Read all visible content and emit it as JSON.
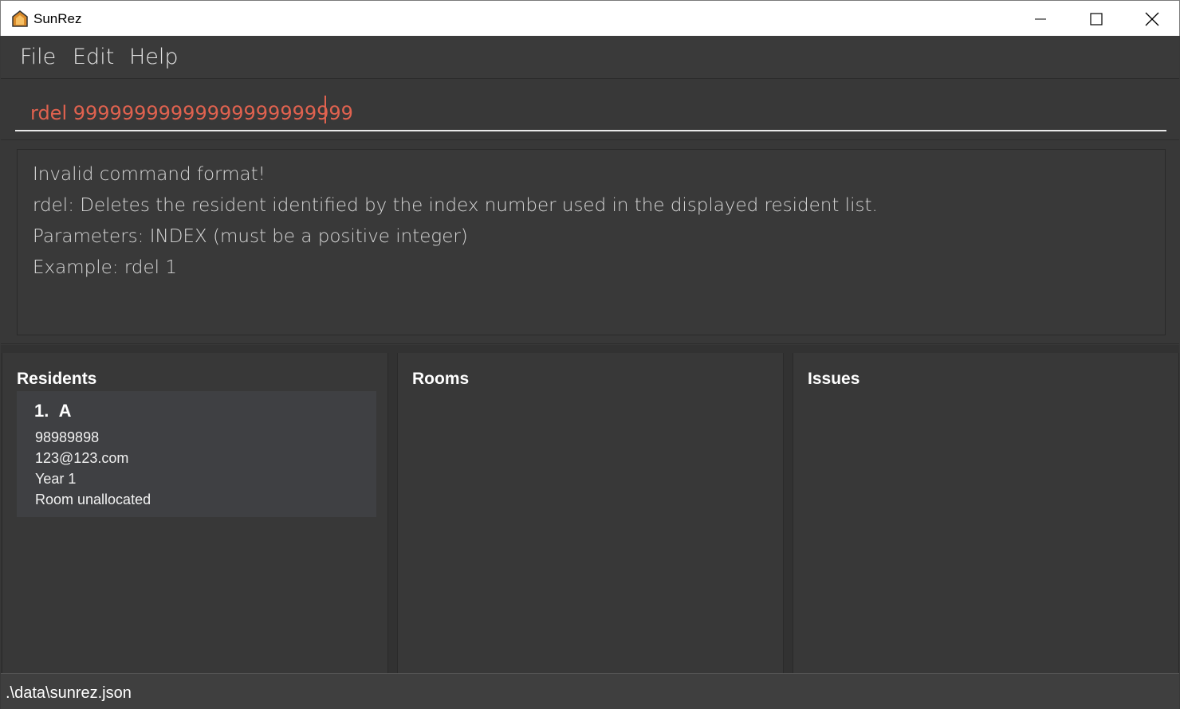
{
  "window": {
    "title": "SunRez",
    "icon": "house-icon",
    "controls": [
      "minimize-icon",
      "maximize-icon",
      "close-icon"
    ]
  },
  "menu": {
    "items": [
      "File",
      "Edit",
      "Help"
    ]
  },
  "command": {
    "value": "rdel 99999999999999999999999"
  },
  "result": {
    "lines": [
      "Invalid command format!",
      "rdel: Deletes the resident identified by the index number used in the displayed resident list.",
      "Parameters: INDEX (must be a positive integer)",
      "Example: rdel 1"
    ]
  },
  "panels": {
    "residents": {
      "title": "Residents",
      "items": [
        {
          "index": "1.",
          "name": "A",
          "phone": "98989898",
          "email": "123@123.com",
          "year": "Year 1",
          "room": "Room unallocated"
        }
      ]
    },
    "rooms": {
      "title": "Rooms"
    },
    "issues": {
      "title": "Issues"
    }
  },
  "status": {
    "path": ".\\data\\sunrez.json"
  },
  "colors": {
    "accent_error": "#e0624f",
    "background": "#383838"
  }
}
